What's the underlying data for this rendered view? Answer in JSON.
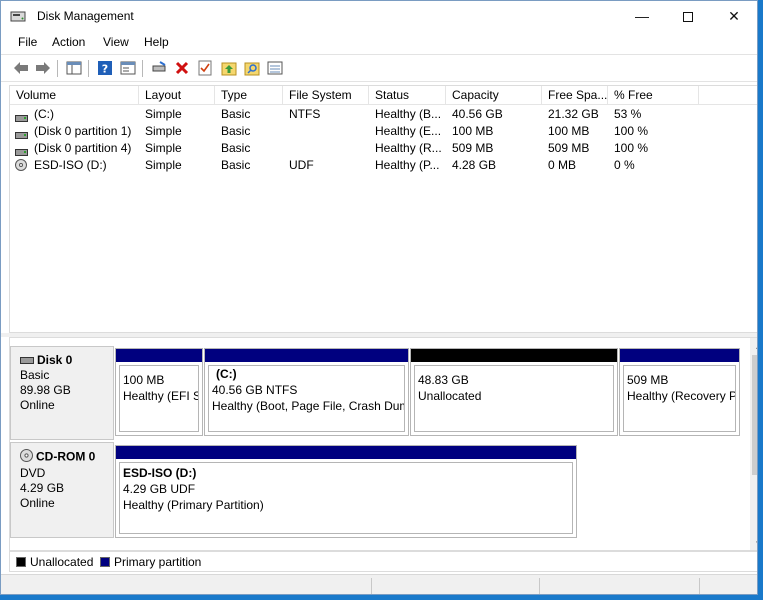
{
  "window": {
    "title": "Disk Management"
  },
  "menu": [
    "File",
    "Action",
    "View",
    "Help"
  ],
  "toolbar": [
    {
      "icon": "back-arrow-icon"
    },
    {
      "icon": "forward-arrow-icon"
    },
    {
      "icon": "console-tree-icon"
    },
    {
      "icon": "help-icon"
    },
    {
      "icon": "show-pane-icon"
    },
    {
      "icon": "connect-disk-icon"
    },
    {
      "icon": "delete-icon"
    },
    {
      "icon": "properties-check-icon"
    },
    {
      "icon": "up-folder-icon"
    },
    {
      "icon": "search-folder-icon"
    },
    {
      "icon": "list-view-icon"
    }
  ],
  "volume_list": {
    "columns": [
      "Volume",
      "Layout",
      "Type",
      "File System",
      "Status",
      "Capacity",
      "Free Spa...",
      "% Free"
    ],
    "rows": [
      {
        "volume": "(C:)",
        "layout": "Simple",
        "type": "Basic",
        "fs": "NTFS",
        "status": "Healthy (B...",
        "capacity": "40.56 GB",
        "free": "21.32 GB",
        "pct": "53 %",
        "icon": "disk-volume-icon"
      },
      {
        "volume": "(Disk 0 partition 1)",
        "layout": "Simple",
        "type": "Basic",
        "fs": "",
        "status": "Healthy (E...",
        "capacity": "100 MB",
        "free": "100 MB",
        "pct": "100 %",
        "icon": "disk-volume-icon"
      },
      {
        "volume": "(Disk 0 partition 4)",
        "layout": "Simple",
        "type": "Basic",
        "fs": "",
        "status": "Healthy (R...",
        "capacity": "509 MB",
        "free": "509 MB",
        "pct": "100 %",
        "icon": "disk-volume-icon"
      },
      {
        "volume": "ESD-ISO (D:)",
        "layout": "Simple",
        "type": "Basic",
        "fs": "UDF",
        "status": "Healthy (P...",
        "capacity": "4.28 GB",
        "free": "0 MB",
        "pct": "0 %",
        "icon": "optical-disc-icon"
      }
    ]
  },
  "disks": [
    {
      "name": "Disk 0",
      "kind": "Basic",
      "size": "89.98 GB",
      "state": "Online",
      "partitions": [
        {
          "name": "",
          "line1": "100 MB",
          "line2": "Healthy (EFI S",
          "style": "primary"
        },
        {
          "name": "(C:)",
          "line1": "40.56 GB NTFS",
          "line2": "Healthy (Boot, Page File, Crash Dum",
          "style": "primary"
        },
        {
          "name": "",
          "line1": "48.83 GB",
          "line2": "Unallocated",
          "style": "unallocated"
        },
        {
          "name": "",
          "line1": "509 MB",
          "line2": "Healthy (Recovery P",
          "style": "primary"
        }
      ]
    },
    {
      "name": "CD-ROM 0",
      "kind": "DVD",
      "size": "4.29 GB",
      "state": "Online",
      "partitions": [
        {
          "name": "ESD-ISO  (D:)",
          "line1": "4.29 GB UDF",
          "line2": "Healthy (Primary Partition)",
          "style": "primary"
        }
      ]
    }
  ],
  "legend": [
    {
      "label": "Unallocated",
      "color": "#000000"
    },
    {
      "label": "Primary partition",
      "color": "#000080"
    }
  ],
  "colors": {
    "primary": "#00007f",
    "unallocated": "#000000"
  }
}
